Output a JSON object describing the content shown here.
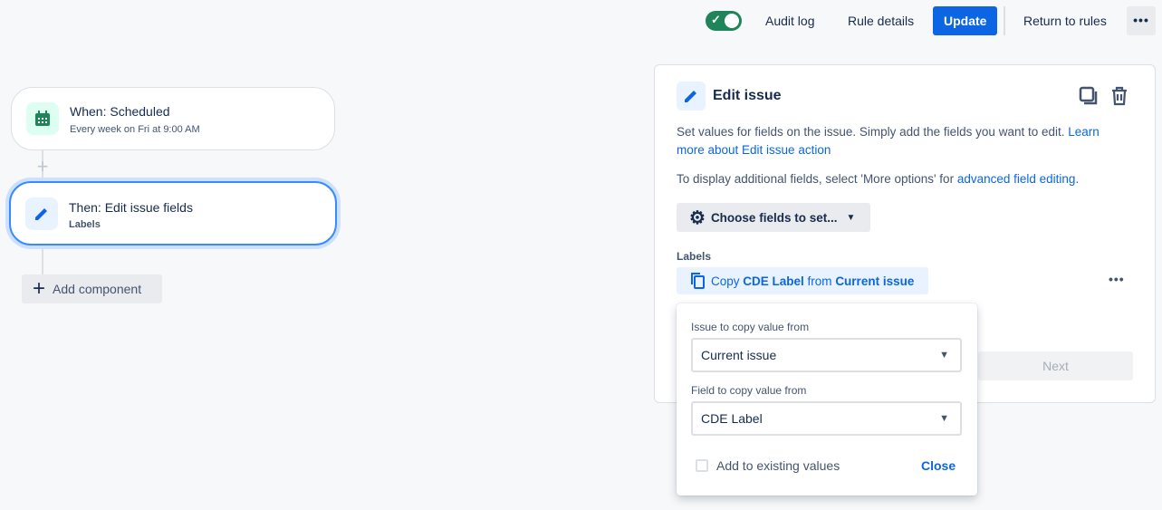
{
  "topbar": {
    "toggle_on": true,
    "audit_log": "Audit log",
    "rule_details": "Rule details",
    "update": "Update",
    "return": "Return to rules"
  },
  "flow": {
    "trigger": {
      "title": "When: Scheduled",
      "subtitle": "Every week on Fri at 9:00 AM"
    },
    "action": {
      "title": "Then: Edit issue fields",
      "subtitle": "Labels"
    },
    "add_component": "Add component"
  },
  "panel": {
    "title": "Edit issue",
    "desc": "Set values for fields on the issue. Simply add the fields you want to edit. ",
    "desc_link": "Learn more about Edit issue action",
    "desc2": "To display additional fields, select 'More options' for ",
    "desc2_link": "advanced field editing",
    "desc2_end": ".",
    "choose": "Choose fields to set...",
    "labels_label": "Labels",
    "chip": {
      "p1": "Copy ",
      "p2": "CDE Label",
      "p3": " from ",
      "p4": "Current issue"
    },
    "next": "Next"
  },
  "popup": {
    "issue_label": "Issue to copy value from",
    "issue_value": "Current issue",
    "field_label": "Field to copy value from",
    "field_value": "CDE Label",
    "checkbox_label": "Add to existing values",
    "checkbox_checked": false,
    "close": "Close"
  }
}
